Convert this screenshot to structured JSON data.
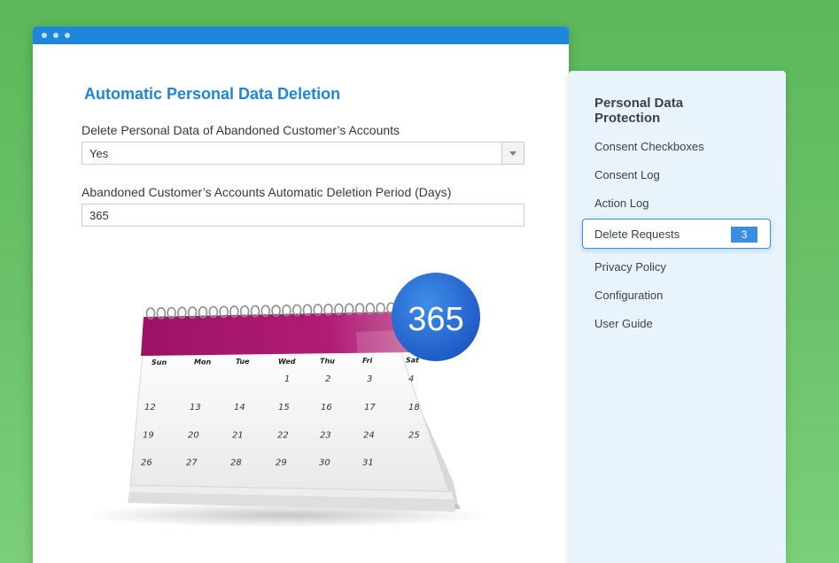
{
  "main": {
    "heading": "Automatic Personal Data Deletion",
    "field1": {
      "label": "Delete Personal Data of Abandoned Customer’s Accounts",
      "value": "Yes"
    },
    "field2": {
      "label": "Abandoned Customer’s Accounts Automatic Deletion Period (Days)",
      "value": "365"
    }
  },
  "calendar": {
    "badge": "365",
    "days": [
      "Sun",
      "Mon",
      "Tue",
      "Wed",
      "Thu",
      "Fri",
      "Sat"
    ],
    "weeks": [
      [
        "",
        "",
        "",
        "1",
        "2",
        "3",
        "4"
      ],
      [
        "12",
        "13",
        "14",
        "15",
        "16",
        "17",
        "18"
      ],
      [
        "19",
        "20",
        "21",
        "22",
        "23",
        "24",
        "25"
      ],
      [
        "26",
        "27",
        "28",
        "29",
        "30",
        "31",
        ""
      ]
    ],
    "colors": {
      "header": "#a3166b",
      "badge": "#2d72d6"
    }
  },
  "sidebar": {
    "title": "Personal Data Protection",
    "items": [
      {
        "label": "Consent Checkboxes"
      },
      {
        "label": "Consent Log"
      },
      {
        "label": "Action Log"
      },
      {
        "label": "Delete Requests",
        "badge": "3"
      },
      {
        "label": "Privacy Policy"
      },
      {
        "label": "Configuration"
      },
      {
        "label": "User Guide"
      }
    ]
  }
}
